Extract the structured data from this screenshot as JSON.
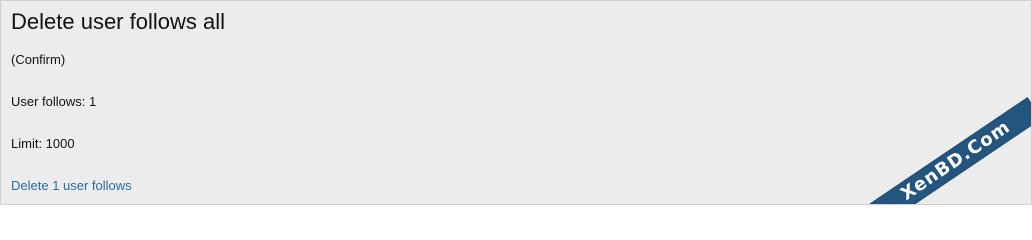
{
  "page": {
    "title": "Delete user follows all",
    "confirm_text": "(Confirm)",
    "user_follows_text": "User follows: 1",
    "limit_text": "Limit: 1000",
    "action_link": "Delete 1 user follows"
  },
  "watermark": {
    "text": "XenBD.Com",
    "color": "#23557f"
  }
}
